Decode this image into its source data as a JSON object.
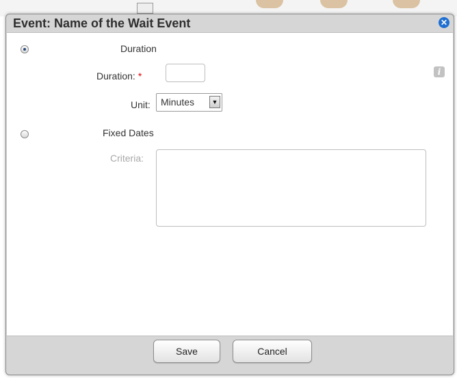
{
  "dialog": {
    "title": "Event: Name of the Wait Event",
    "close_icon": "close-icon"
  },
  "options": {
    "duration": {
      "label": "Duration",
      "selected": true
    },
    "fixed_dates": {
      "label": "Fixed Dates",
      "selected": false
    }
  },
  "duration_field": {
    "label": "Duration:",
    "required_marker": "*",
    "value": ""
  },
  "unit_field": {
    "label": "Unit:",
    "value": "Minutes",
    "arrow": "▼"
  },
  "criteria_field": {
    "label": "Criteria:",
    "value": ""
  },
  "info_icon": {
    "name": "info-icon",
    "glyph": "i"
  },
  "buttons": {
    "save": "Save",
    "cancel": "Cancel"
  },
  "colors": {
    "accent": "#1e6fd1",
    "required": "#dd0000",
    "disabled_text": "#a8a8a8"
  }
}
